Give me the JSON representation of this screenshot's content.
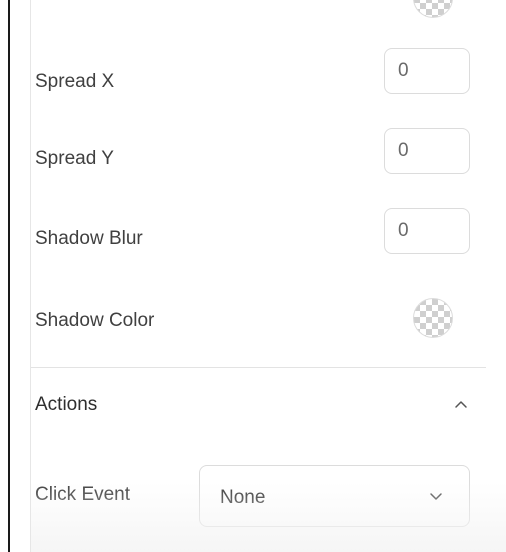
{
  "effects": {
    "top_swatch_icon": "checkerboard-swatch-icon",
    "spread_x": {
      "label": "Spread X",
      "value": "0"
    },
    "spread_y": {
      "label": "Spread Y",
      "value": "0"
    },
    "shadow_blur": {
      "label": "Shadow Blur",
      "value": "0"
    },
    "shadow_color": {
      "label": "Shadow Color",
      "icon": "transparent-color-swatch-icon"
    }
  },
  "actions": {
    "title": "Actions",
    "collapse_icon": "chevron-up-icon",
    "click_event": {
      "label": "Click Event",
      "selected": "None",
      "dropdown_icon": "chevron-down-icon"
    }
  },
  "colors": {
    "border": "#dcdcdc",
    "checker": "#cfcfcf",
    "text": "#404040"
  }
}
